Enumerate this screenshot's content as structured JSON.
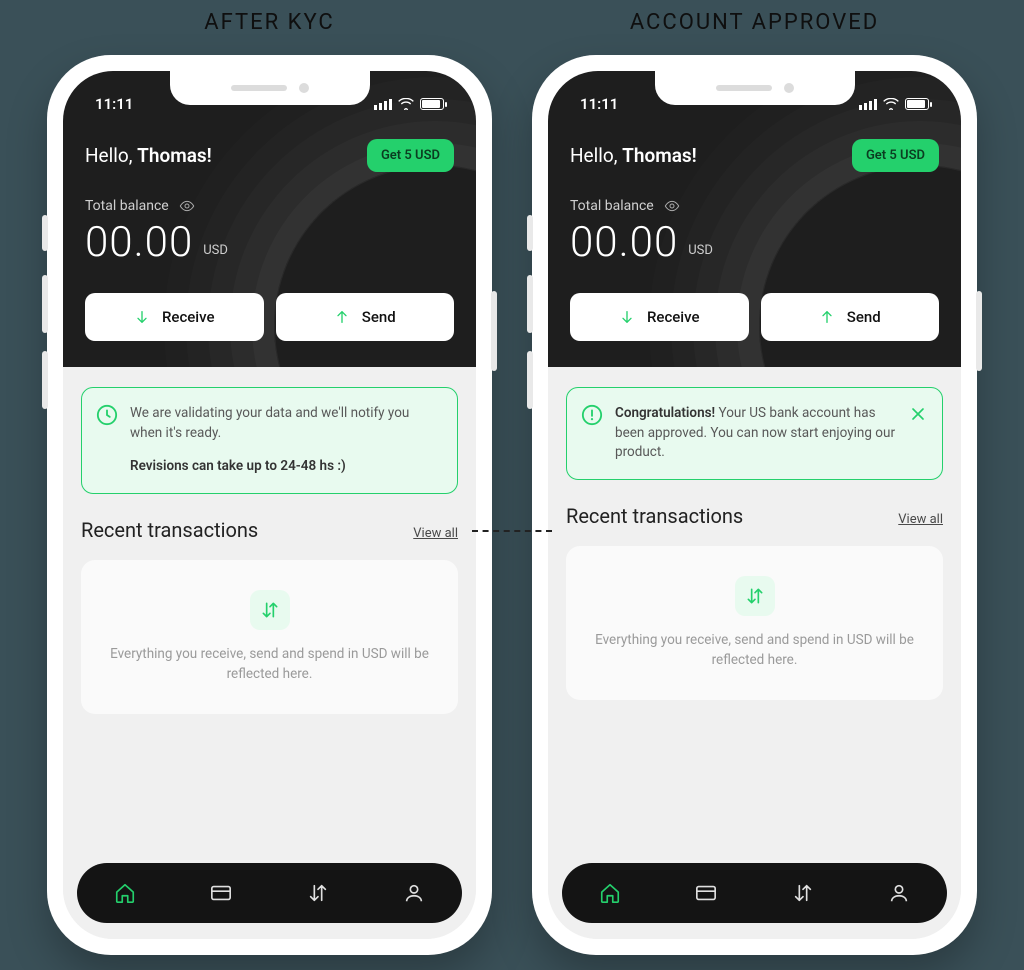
{
  "captions": {
    "left": "AFTER KYC",
    "right": "ACCOUNT APPROVED"
  },
  "statusbar": {
    "time": "11:11"
  },
  "hero": {
    "greeting_prefix": "Hello, ",
    "username": "Thomas!",
    "promo_label": "Get 5 USD",
    "balance_label": "Total balance",
    "balance_amount": "00.00",
    "balance_currency": "USD",
    "receive_label": "Receive",
    "send_label": "Send"
  },
  "notice": {
    "validating_line1": "We are validating your data and we'll notify you when it's ready.",
    "validating_line2": "Revisions can take up to 24-48 hs :)",
    "approved_bold": "Congratulations!",
    "approved_rest": " Your US bank account has been approved. You can now start enjoying our product."
  },
  "transactions": {
    "section_title": "Recent transactions",
    "view_all_label": "View all",
    "empty_text": "Everything you receive, send and spend in USD will be reflected here."
  },
  "nav": {
    "home": "home",
    "card": "card",
    "activity": "activity",
    "profile": "profile"
  }
}
